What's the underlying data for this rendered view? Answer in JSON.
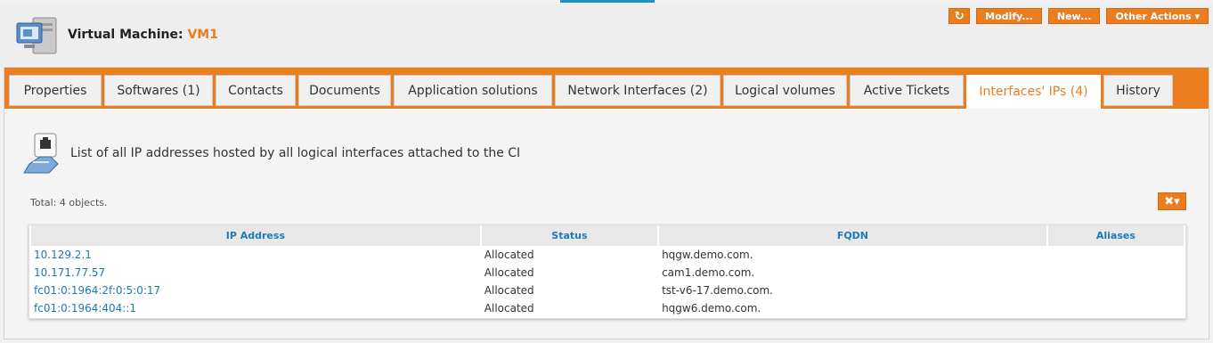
{
  "header": {
    "title_prefix": "Virtual Machine: ",
    "object_name": "VM1",
    "actions": [
      {
        "label": "↻",
        "icon": "refresh-icon"
      },
      {
        "label": "Modify..."
      },
      {
        "label": "New..."
      },
      {
        "label": "Other Actions ▾"
      }
    ]
  },
  "tabs": [
    {
      "label": "Properties"
    },
    {
      "label": "Softwares (1)"
    },
    {
      "label": "Contacts"
    },
    {
      "label": "Documents"
    },
    {
      "label": "Application solutions"
    },
    {
      "label": "Network Interfaces (2)"
    },
    {
      "label": "Logical volumes"
    },
    {
      "label": "Active Tickets"
    },
    {
      "label": "Interfaces' IPs (4)"
    },
    {
      "label": "History"
    }
  ],
  "content": {
    "description": "List of all IP addresses hosted by all logical interfaces attached to the CI",
    "total": "Total: 4 objects.",
    "tools_icon": "tools-icon"
  },
  "table": {
    "columns": [
      "IP Address",
      "Status",
      "FQDN",
      "Aliases"
    ],
    "rows": [
      [
        "10.129.2.1",
        "Allocated",
        "hqgw.demo.com.",
        ""
      ],
      [
        "10.171.77.57",
        "Allocated",
        "cam1.demo.com.",
        ""
      ],
      [
        "fc01:0:1964:2f:0:5:0:17",
        "Allocated",
        "tst-v6-17.demo.com.",
        ""
      ],
      [
        "fc01:0:1964:404::1",
        "Allocated",
        "hqgw6.demo.com.",
        ""
      ]
    ]
  },
  "colors": {
    "accent": "#ea7d1e",
    "link": "#1c7ab8"
  }
}
